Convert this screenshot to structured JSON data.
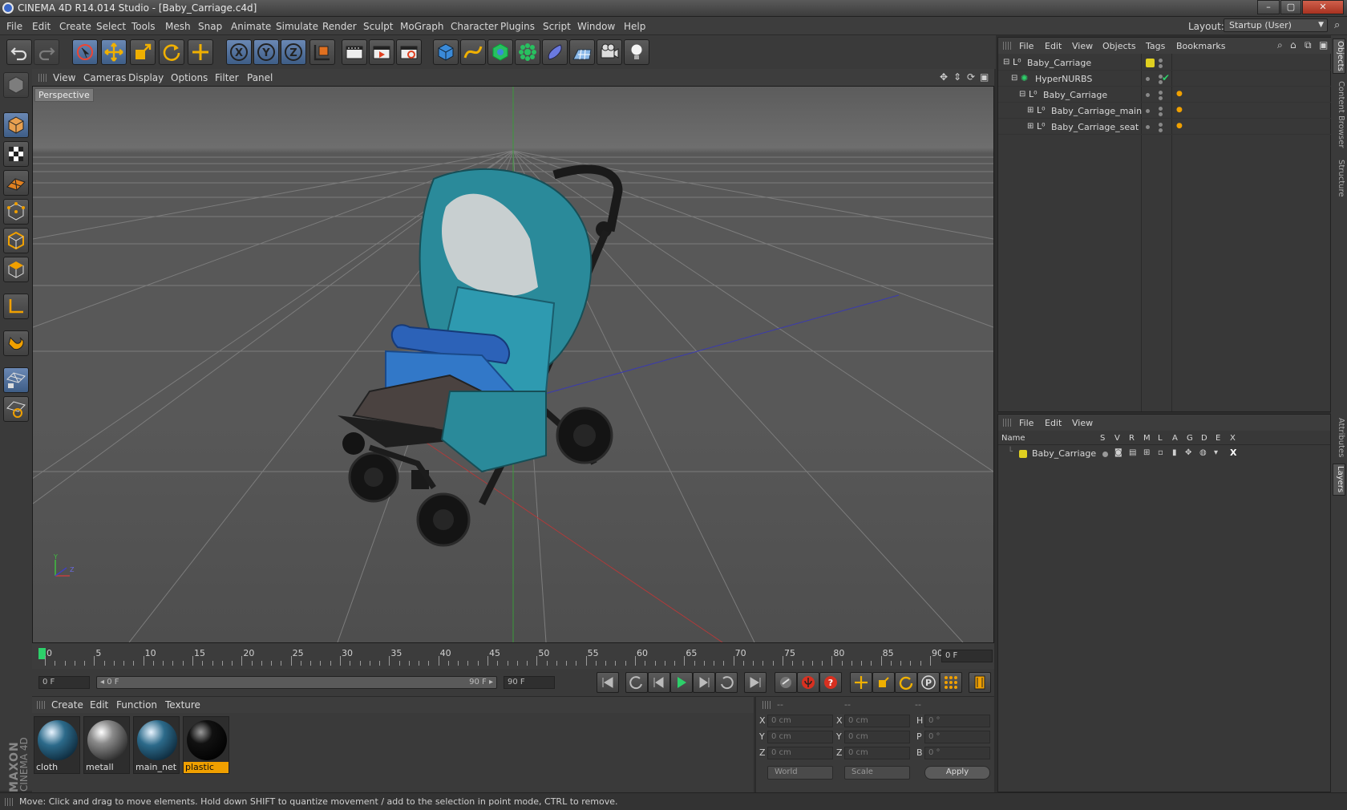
{
  "window": {
    "title": "CINEMA 4D R14.014 Studio - [Baby_Carriage.c4d]",
    "buttons": [
      "–",
      "▢",
      "✕"
    ]
  },
  "menubar": {
    "items": [
      "File",
      "Edit",
      "Create",
      "Select",
      "Tools",
      "Mesh",
      "Snap",
      "Animate",
      "Simulate",
      "Render",
      "Sculpt",
      "MoGraph",
      "Character",
      "Plugins",
      "Script",
      "Window",
      "Help"
    ],
    "layout_label": "Layout:",
    "layout_value": "Startup (User)"
  },
  "toolbar": {
    "icons": [
      "undo-icon",
      "redo-icon",
      "live-selection-icon",
      "move-icon",
      "scale-icon",
      "rotate-icon",
      "last-tool-icon",
      "x-axis-icon",
      "y-axis-icon",
      "z-axis-icon",
      "coordinate-system-icon",
      "render-view-icon",
      "render-picture-viewer-icon",
      "render-settings-icon",
      "cube-icon",
      "spline-icon",
      "nurbs-icon",
      "array-icon",
      "deformer-icon",
      "floor-icon",
      "camera-icon",
      "light-icon"
    ],
    "axis_letters": [
      "X",
      "Y",
      "Z"
    ]
  },
  "left_toolbar": {
    "icons": [
      "make-editable-icon",
      "model-mode-icon",
      "texture-mode-icon",
      "workplane-icon",
      "points-mode-icon",
      "edges-mode-icon",
      "polygons-mode-icon",
      "axis-mode-icon",
      "snap-magnet-icon",
      "locked-workplane-icon",
      "planar-workplane-icon"
    ]
  },
  "viewport": {
    "menu": [
      "View",
      "Cameras",
      "Display",
      "Options",
      "Filter",
      "Panel"
    ],
    "label": "Perspective",
    "axis_labels": [
      "Y",
      "Z"
    ]
  },
  "timeline": {
    "ticks": [
      "0",
      "5",
      "10",
      "15",
      "20",
      "25",
      "30",
      "35",
      "40",
      "45",
      "50",
      "55",
      "60",
      "65",
      "70",
      "75",
      "80",
      "85",
      "90"
    ],
    "current_frame": "0 F"
  },
  "transport": {
    "start_field": "0 F",
    "range_start": "◂ 0 F",
    "range_end": "90 F ▸",
    "end_field": "90 F"
  },
  "materials": {
    "menu": [
      "Create",
      "Edit",
      "Function",
      "Texture"
    ],
    "items": [
      {
        "name": "cloth",
        "selected": false,
        "color": "#2c6a8a"
      },
      {
        "name": "metall",
        "selected": false,
        "color": "#8a8a8a"
      },
      {
        "name": "main_net",
        "selected": false,
        "color": "#2c6a8a"
      },
      {
        "name": "plastic",
        "selected": true,
        "color": "#111111"
      }
    ]
  },
  "coordinates": {
    "headers": [
      "--",
      "--",
      "--"
    ],
    "rows": [
      {
        "a": "X",
        "av": "0 cm",
        "b": "X",
        "bv": "0 cm",
        "c": "H",
        "cv": "0 °"
      },
      {
        "a": "Y",
        "av": "0 cm",
        "b": "Y",
        "bv": "0 cm",
        "c": "P",
        "cv": "0 °"
      },
      {
        "a": "Z",
        "av": "0 cm",
        "b": "Z",
        "bv": "0 cm",
        "c": "B",
        "cv": "0 °"
      }
    ],
    "world": "World",
    "scale": "Scale",
    "apply": "Apply"
  },
  "status": "Move: Click and drag to move elements. Hold down SHIFT to quantize movement / add to the selection in point mode, CTRL to remove.",
  "objects": {
    "menu": [
      "File",
      "Edit",
      "View",
      "Objects",
      "Tags",
      "Bookmarks"
    ],
    "rows": [
      {
        "name": "Baby_Carriage",
        "indent": 0
      },
      {
        "name": "HyperNURBS",
        "indent": 1
      },
      {
        "name": "Baby_Carriage",
        "indent": 2
      },
      {
        "name": "Baby_Carriage_main",
        "indent": 3
      },
      {
        "name": "Baby_Carriage_seat",
        "indent": 3
      }
    ]
  },
  "layers": {
    "menu": [
      "File",
      "Edit",
      "View"
    ],
    "columns": [
      "Name",
      "S",
      "V",
      "R",
      "M",
      "L",
      "A",
      "G",
      "D",
      "E",
      "X"
    ],
    "row_name": "Baby_Carriage",
    "layer_color": "#e0d020"
  },
  "side_tabs": {
    "top": [
      "Objects",
      "Content Browser",
      "Structure"
    ],
    "bottom": [
      "Attributes",
      "Layers"
    ]
  },
  "brand": {
    "maxon": "MAXON",
    "product": "CINEMA 4D"
  },
  "colors": {
    "accent_orange": "#f0a000",
    "select_blue": "#5a7cab",
    "green_marker": "#2dd06a"
  }
}
